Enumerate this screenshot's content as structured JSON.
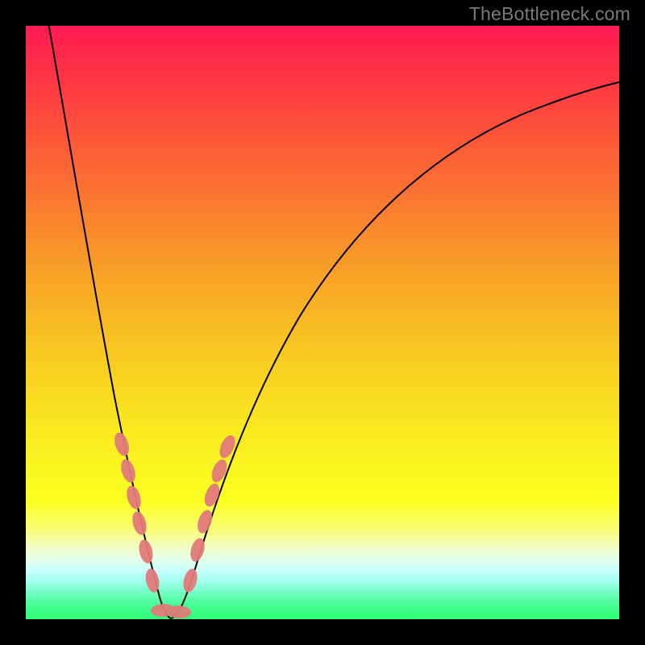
{
  "watermark": {
    "text": "TheBottleneck.com"
  },
  "chart_data": {
    "type": "line",
    "title": "",
    "xlabel": "",
    "ylabel": "",
    "xlim": [
      0,
      100
    ],
    "ylim": [
      0,
      100
    ],
    "grid": false,
    "legend": false,
    "curve_note": "V-shaped bottleneck percentage curve with minimum near x≈22; left branch steep, right branch sweeping toward top-right",
    "series": [
      {
        "name": "bottleneck-curve",
        "x": [
          4,
          6,
          8,
          10,
          12,
          14,
          16,
          18,
          20,
          22,
          24,
          26,
          28,
          30,
          34,
          40,
          48,
          58,
          70,
          84,
          100
        ],
        "y": [
          100,
          88,
          76,
          64,
          52,
          40,
          29,
          18,
          8,
          1,
          5,
          13,
          22,
          30,
          43,
          57,
          69,
          78,
          85,
          89,
          91
        ]
      }
    ],
    "markers": {
      "note": "salmon pill markers near curve minimum",
      "color": "#e27b7b",
      "points": [
        {
          "x": 14.5,
          "y": 30
        },
        {
          "x": 15.5,
          "y": 25
        },
        {
          "x": 16.2,
          "y": 20
        },
        {
          "x": 17.0,
          "y": 16
        },
        {
          "x": 18.0,
          "y": 11
        },
        {
          "x": 19.0,
          "y": 6.5
        },
        {
          "x": 21.0,
          "y": 1.2
        },
        {
          "x": 22.5,
          "y": 1.0
        },
        {
          "x": 24.0,
          "y": 1.3
        },
        {
          "x": 26.0,
          "y": 8.5
        },
        {
          "x": 27.0,
          "y": 14
        },
        {
          "x": 28.0,
          "y": 19
        },
        {
          "x": 28.8,
          "y": 23
        },
        {
          "x": 30.0,
          "y": 29
        }
      ]
    },
    "background_gradient": {
      "stops": [
        {
          "pct": 0,
          "color": "#ff1a53"
        },
        {
          "pct": 30,
          "color": "#fa7a2f"
        },
        {
          "pct": 70,
          "color": "#faee1f"
        },
        {
          "pct": 99,
          "color": "#32fe7b"
        }
      ]
    }
  }
}
